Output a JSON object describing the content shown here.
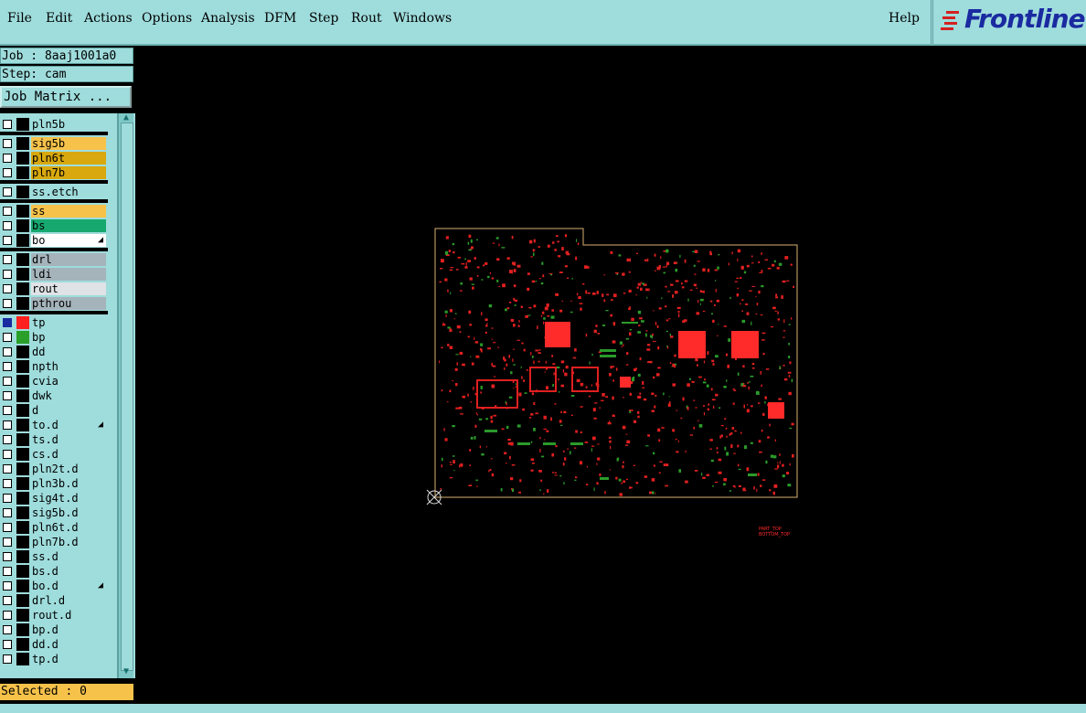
{
  "menu": {
    "file": "File",
    "edit": "Edit",
    "actions": "Actions",
    "options": "Options",
    "analysis": "Analysis",
    "dfm": "DFM",
    "step": "Step",
    "rout": "Rout",
    "windows": "Windows",
    "help": "Help"
  },
  "logo": "Frontline",
  "job": "Job : 8aaj1001a0",
  "step": "Step: cam",
  "job_matrix": "Job Matrix ...",
  "layers": [
    {
      "name": "pln5b",
      "bg": "#9fdcdc"
    },
    {
      "name": "sig5b",
      "bg": "#f6c24a"
    },
    {
      "name": "pln6t",
      "bg": "#d8a80e"
    },
    {
      "name": "pln7b",
      "bg": "#d8a80e"
    },
    {
      "name": "ss.etch",
      "bg": "#9fdcdc"
    },
    {
      "name": "ss",
      "bg": "#f6c24a"
    },
    {
      "name": "bs",
      "bg": "#17a870"
    },
    {
      "name": "bo",
      "bg": "#ffffff"
    },
    {
      "name": "drl",
      "bg": "#a5b3bb"
    },
    {
      "name": "ldi",
      "bg": "#a5b3bb"
    },
    {
      "name": "rout",
      "bg": "#dfe3e6"
    },
    {
      "name": "pthrou",
      "bg": "#a5b3bb"
    },
    {
      "name": "tp",
      "bg": "#9fdcdc"
    },
    {
      "name": "bp",
      "bg": "#9fdcdc"
    },
    {
      "name": "dd",
      "bg": "#9fdcdc"
    },
    {
      "name": "npth",
      "bg": "#9fdcdc"
    },
    {
      "name": "cvia",
      "bg": "#9fdcdc"
    },
    {
      "name": "dwk",
      "bg": "#9fdcdc"
    },
    {
      "name": "d",
      "bg": "#9fdcdc"
    },
    {
      "name": "to.d",
      "bg": "#9fdcdc"
    },
    {
      "name": "ts.d",
      "bg": "#9fdcdc"
    },
    {
      "name": "cs.d",
      "bg": "#9fdcdc"
    },
    {
      "name": "pln2t.d",
      "bg": "#9fdcdc"
    },
    {
      "name": "pln3b.d",
      "bg": "#9fdcdc"
    },
    {
      "name": "sig4t.d",
      "bg": "#9fdcdc"
    },
    {
      "name": "sig5b.d",
      "bg": "#9fdcdc"
    },
    {
      "name": "pln6t.d",
      "bg": "#9fdcdc"
    },
    {
      "name": "pln7b.d",
      "bg": "#9fdcdc"
    },
    {
      "name": "ss.d",
      "bg": "#9fdcdc"
    },
    {
      "name": "bs.d",
      "bg": "#9fdcdc"
    },
    {
      "name": "bo.d",
      "bg": "#9fdcdc"
    },
    {
      "name": "drl.d",
      "bg": "#9fdcdc"
    },
    {
      "name": "rout.d",
      "bg": "#9fdcdc"
    },
    {
      "name": "bp.d",
      "bg": "#9fdcdc"
    },
    {
      "name": "dd.d",
      "bg": "#9fdcdc"
    },
    {
      "name": "tp.d",
      "bg": "#9fdcdc"
    }
  ],
  "selected": "Selected : 0",
  "canvas_text": {
    "line1": "PART_TOP",
    "line2": "BOTTOM_TOP"
  }
}
